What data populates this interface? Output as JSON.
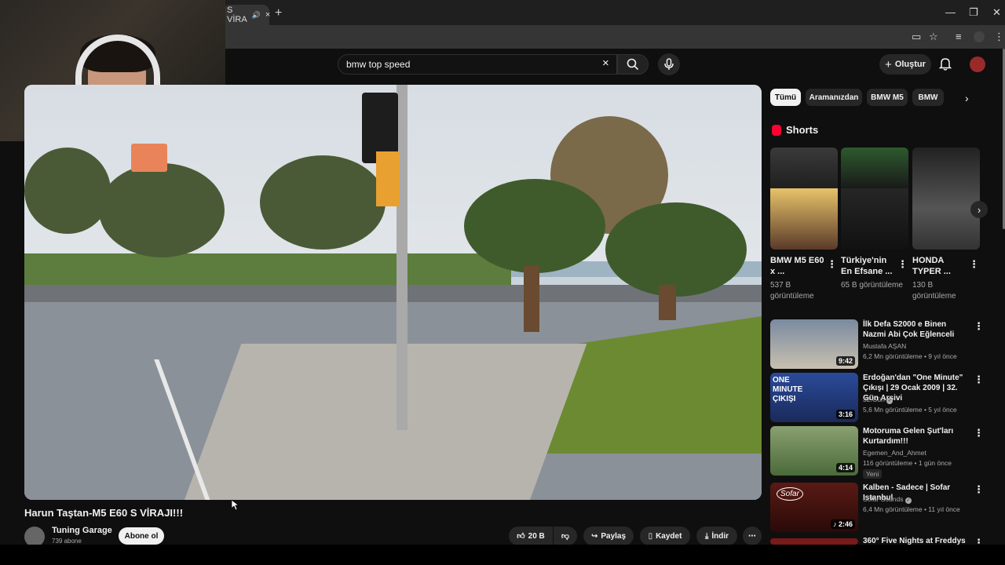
{
  "browser": {
    "tab_title": "S VİRA",
    "tab_close": "×",
    "new_tab": "+"
  },
  "search": {
    "query": "bmw top speed",
    "clear": "×"
  },
  "masthead": {
    "create_label": "Oluştur"
  },
  "video": {
    "title": "Harun Taştan-M5 E60 S VİRAJI!!!",
    "channel": "Tuning Garage",
    "subscribers": "739 abone",
    "subscribe_label": "Abone ol",
    "like_count": "20 B",
    "share_label": "Paylaş",
    "save_label": "Kaydet",
    "download_label": "İndir"
  },
  "chips": [
    "Tümü",
    "Aramanızdan",
    "BMW M5",
    "BMW"
  ],
  "shorts": {
    "header": "Shorts",
    "items": [
      {
        "title": "BMW M5 E60 x ...",
        "views": "537 B görüntüleme"
      },
      {
        "title": "Türkiye'nin En Efsane ...",
        "views": "65 B görüntüleme"
      },
      {
        "title": "HONDA TYPER ...",
        "views": "130 B görüntüleme"
      }
    ]
  },
  "related": [
    {
      "title": "İlk Defa S2000 e Binen Nazmi Abi Çok Eğlenceli",
      "channel": "Mustafa AŞAN",
      "meta": "6,2 Mn görüntüleme • 9 yıl önce",
      "duration": "9:42"
    },
    {
      "title": "Erdoğan'dan \"One Minute\" Çıkışı | 29 Ocak 2009 | 32. Gün Arşivi",
      "channel": "32.Gün",
      "meta": "5,6 Mn görüntüleme • 5 yıl önce",
      "duration": "3:16",
      "thumb_text": "ONE MINUTE ÇIKIŞI"
    },
    {
      "title": "Motoruma Gelen Şut'ları Kurtardım!!!",
      "channel": "Egemen_And_Ahmet",
      "meta": "116 görüntüleme • 1 gün önce",
      "duration": "4:14",
      "badge": "Yeni"
    },
    {
      "title": "Kalben - Sadece | Sofar Istanbul",
      "channel": "Sofar Sounds",
      "meta": "6,4 Mn görüntüleme • 11 yıl önce",
      "duration": "2:46"
    },
    {
      "title": "360° Five Nights at Freddys",
      "channel": "",
      "meta": "",
      "duration": ""
    }
  ],
  "colors": {
    "bg": "#0f0f0f",
    "accent_red": "#ff0033",
    "chip": "#272727"
  }
}
